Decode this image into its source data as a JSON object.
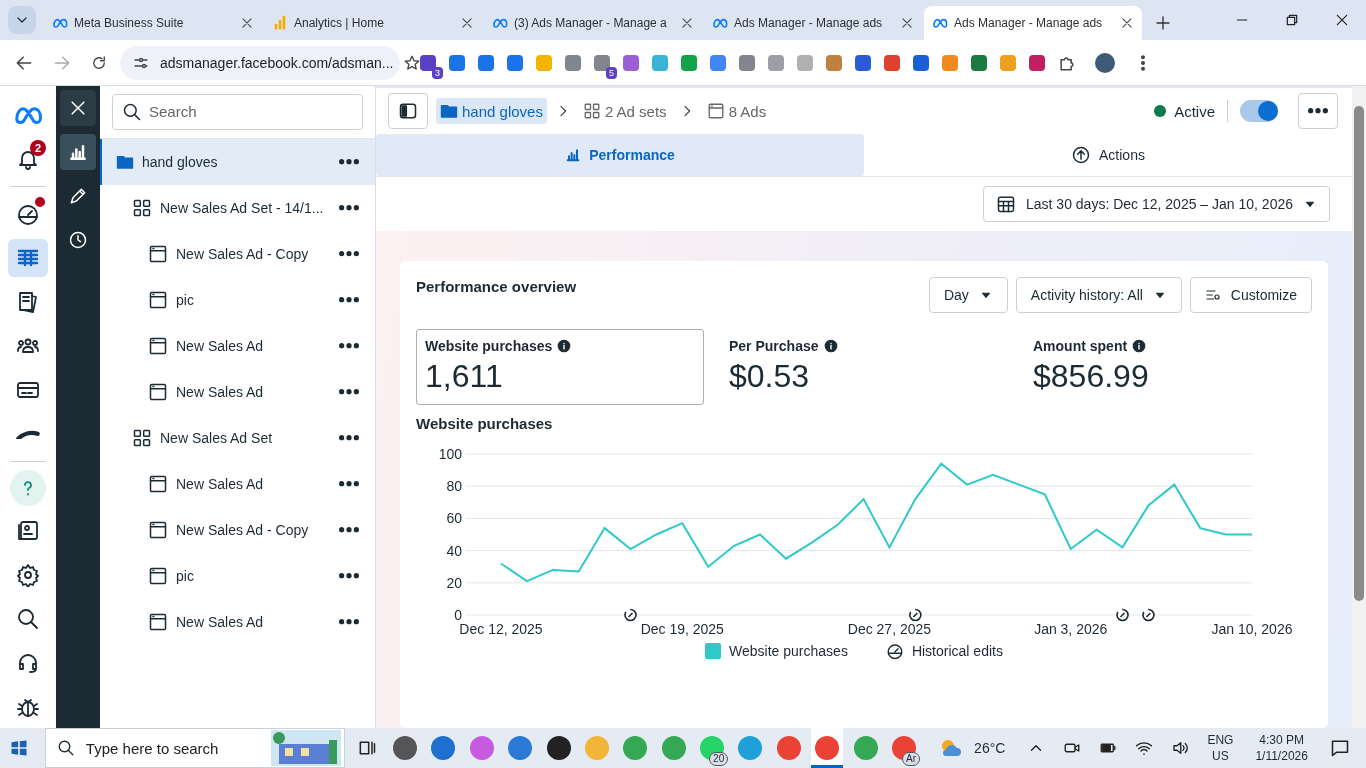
{
  "browser": {
    "tabs": [
      {
        "title": "Meta Business Suite",
        "kind": "meta",
        "selected": false
      },
      {
        "title": "Analytics | Home",
        "kind": "analytics",
        "selected": false
      },
      {
        "title": "(3) Ads Manager - Manage a",
        "kind": "meta",
        "selected": false
      },
      {
        "title": "Ads Manager - Manage ads",
        "kind": "meta",
        "selected": false
      },
      {
        "title": "Ads Manager - Manage ads",
        "kind": "meta",
        "selected": true
      }
    ],
    "address": "adsmanager.facebook.com/adsman...",
    "extensions": [
      {
        "color": "#5b3fc4",
        "badge": "3"
      },
      {
        "color": "#1a73e8"
      },
      {
        "color": "#1a73e8"
      },
      {
        "color": "#1a73e8"
      },
      {
        "color": "#f4b400"
      },
      {
        "color": "#80868b"
      },
      {
        "color": "#80868b",
        "badge": "5"
      },
      {
        "color": "#9c5fd6"
      },
      {
        "color": "#3ab3d6"
      },
      {
        "color": "#15a34a"
      },
      {
        "color": "#4285f4"
      },
      {
        "color": "#80868b"
      },
      {
        "color": "#9aa0a6"
      },
      {
        "color": "#b0b0b0"
      },
      {
        "color": "#c08040"
      },
      {
        "color": "#2b5bd6"
      },
      {
        "color": "#e04030"
      },
      {
        "color": "#1a5fd6"
      },
      {
        "color": "#f08a20"
      },
      {
        "color": "#1a7a40"
      },
      {
        "color": "#f0a020"
      },
      {
        "color": "#c02060"
      }
    ]
  },
  "rail": [
    {
      "kind": "meta-logo",
      "selected": false
    },
    {
      "kind": "bell",
      "badge": "2",
      "selected": false
    },
    {
      "kind": "divider"
    },
    {
      "kind": "gauge",
      "dot": true,
      "selected": false
    },
    {
      "kind": "table",
      "selected": true
    },
    {
      "kind": "pages",
      "selected": false
    },
    {
      "kind": "people",
      "selected": false
    },
    {
      "kind": "card",
      "selected": false
    },
    {
      "kind": "curve",
      "selected": false
    },
    {
      "kind": "divider"
    },
    {
      "kind": "help",
      "selected": false
    },
    {
      "kind": "id-card",
      "selected": false
    },
    {
      "kind": "gear",
      "selected": false
    },
    {
      "kind": "search",
      "selected": false
    },
    {
      "kind": "headset",
      "selected": false
    },
    {
      "kind": "bug",
      "selected": false
    }
  ],
  "tools": [
    {
      "kind": "close",
      "selected": false
    },
    {
      "kind": "bar-chart",
      "selected": true
    },
    {
      "kind": "pencil",
      "selected": false
    },
    {
      "kind": "clock",
      "selected": false
    }
  ],
  "tree": {
    "search_placeholder": "Search",
    "items": [
      {
        "kind": "campaign",
        "label": "hand gloves",
        "selected": true,
        "children": [
          {
            "kind": "adset",
            "label": "New Sales Ad Set - 14/1...",
            "selected": false,
            "children": [
              {
                "kind": "ad",
                "label": "New Sales Ad - Copy",
                "selected": false
              },
              {
                "kind": "ad",
                "label": "pic",
                "selected": false
              },
              {
                "kind": "ad",
                "label": "New Sales Ad",
                "selected": false
              },
              {
                "kind": "ad",
                "label": "New Sales Ad",
                "selected": false
              }
            ]
          },
          {
            "kind": "adset",
            "label": "New Sales Ad Set",
            "selected": false,
            "children": [
              {
                "kind": "ad",
                "label": "New Sales Ad",
                "selected": false
              },
              {
                "kind": "ad",
                "label": "New Sales Ad - Copy",
                "selected": false
              },
              {
                "kind": "ad",
                "label": "pic",
                "selected": false
              },
              {
                "kind": "ad",
                "label": "New Sales Ad",
                "selected": false
              }
            ]
          }
        ]
      }
    ]
  },
  "breadcrumb": [
    {
      "kind": "campaign",
      "label": "hand gloves",
      "selected": true
    },
    {
      "kind": "adset",
      "label": "2 Ad sets",
      "selected": false
    },
    {
      "kind": "ad",
      "label": "8 Ads",
      "selected": false
    }
  ],
  "status": {
    "label": "Active",
    "on": true
  },
  "view_tabs": [
    {
      "kind": "performance",
      "label": "Performance",
      "selected": true
    },
    {
      "kind": "actions",
      "label": "Actions",
      "selected": false
    }
  ],
  "date_range": "Last 30 days: Dec 12, 2025 – Jan 10, 2026",
  "overview": {
    "title": "Performance overview",
    "controls": [
      {
        "kind": "dropdown",
        "label": "Day"
      },
      {
        "kind": "dropdown",
        "label": "Activity history: All"
      },
      {
        "kind": "customize",
        "label": "Customize"
      }
    ],
    "metrics": [
      {
        "label": "Website purchases",
        "value": "1,611",
        "selected": true
      },
      {
        "label": "Per Purchase",
        "value": "$0.53",
        "selected": false
      },
      {
        "label": "Amount spent",
        "value": "$856.99",
        "selected": false
      }
    ],
    "chart_title": "Website purchases",
    "chart_data": {
      "type": "line",
      "categories": [
        "Dec 12, 2025",
        null,
        null,
        null,
        null,
        null,
        null,
        "Dec 19, 2025",
        null,
        null,
        null,
        null,
        null,
        null,
        null,
        "Dec 27, 2025",
        null,
        null,
        null,
        null,
        null,
        null,
        "Jan 3, 2026",
        null,
        null,
        null,
        null,
        null,
        null,
        "Jan 10, 2026"
      ],
      "series": [
        {
          "name": "Website purchases",
          "color": "#2ec9c9",
          "values": [
            32,
            21,
            28,
            27,
            54,
            41,
            50,
            57,
            30,
            43,
            50,
            35,
            45,
            56,
            72,
            42,
            72,
            94,
            81,
            87,
            81,
            75,
            41,
            53,
            42,
            68,
            81,
            54,
            50,
            50
          ]
        }
      ],
      "ylim": [
        0,
        100
      ],
      "yticks": [
        0,
        20,
        40,
        60,
        80,
        100
      ],
      "grid": true
    },
    "edits_legend": "Historical edits"
  },
  "taskbar": {
    "search_placeholder": "Type here to search",
    "apps": [
      {
        "color": "#555555",
        "selected": false
      },
      {
        "color": "#1f6fd1",
        "selected": false
      },
      {
        "color": "#c85ae0",
        "selected": false
      },
      {
        "color": "#2b7bd6",
        "selected": false
      },
      {
        "color": "#222222",
        "selected": false
      },
      {
        "color": "#f2b53a",
        "selected": false
      },
      {
        "color": "#34a853",
        "selected": false
      },
      {
        "color": "#34a853",
        "selected": false
      },
      {
        "color": "#25d366",
        "badge": "20",
        "selected": false
      },
      {
        "color": "#1fa0d8",
        "selected": false
      },
      {
        "color": "#ea4335",
        "selected": false
      },
      {
        "color": "#ea4335",
        "selected": true
      },
      {
        "color": "#34a853",
        "selected": false
      },
      {
        "color": "#ea4335",
        "badge": "Ar",
        "selected": false
      }
    ],
    "temperature": "26°C",
    "language": "ENG",
    "region": "US",
    "time": "4:30 PM",
    "date": "1/11/2026"
  }
}
